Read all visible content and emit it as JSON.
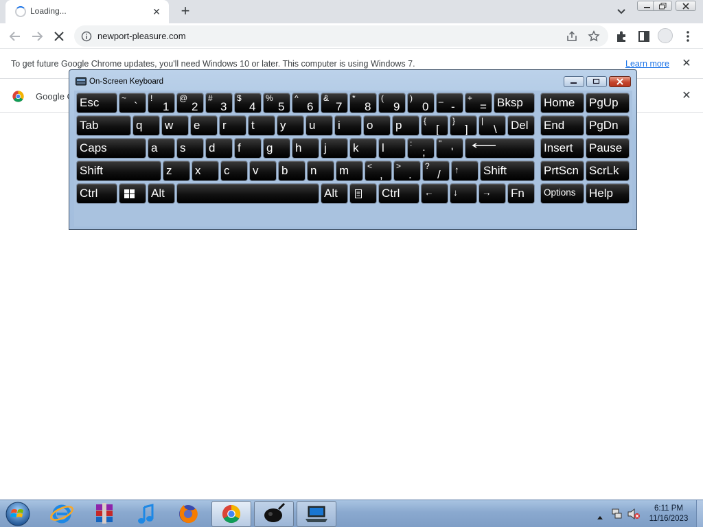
{
  "browser": {
    "tab": {
      "title": "Loading...",
      "close": "✕"
    },
    "new_tab": "+",
    "address": "newport-pleasure.com",
    "infobar_update": {
      "message": "To get future Google Chrome updates, you'll need Windows 10 or later. This computer is using Windows 7.",
      "link": "Learn more",
      "close": "✕"
    },
    "infobar_google": {
      "text": "Google C",
      "close": "✕"
    }
  },
  "osk": {
    "title": "On-Screen Keyboard",
    "rows": [
      [
        {
          "id": "esc",
          "label": "Esc",
          "w": 60
        },
        {
          "id": "tilde",
          "shift": "~",
          "low": "`",
          "w": 40
        },
        {
          "id": "1",
          "shift": "!",
          "low": "1",
          "w": 40
        },
        {
          "id": "2",
          "shift": "@",
          "low": "2",
          "w": 40
        },
        {
          "id": "3",
          "shift": "#",
          "low": "3",
          "w": 40
        },
        {
          "id": "4",
          "shift": "$",
          "low": "4",
          "w": 40
        },
        {
          "id": "5",
          "shift": "%",
          "low": "5",
          "w": 40
        },
        {
          "id": "6",
          "shift": "^",
          "low": "6",
          "w": 40
        },
        {
          "id": "7",
          "shift": "&",
          "low": "7",
          "w": 40
        },
        {
          "id": "8",
          "shift": "*",
          "low": "8",
          "w": 40
        },
        {
          "id": "9",
          "shift": "(",
          "low": "9",
          "w": 40
        },
        {
          "id": "0",
          "shift": ")",
          "low": "0",
          "w": 40
        },
        {
          "id": "minus",
          "shift": "_",
          "low": "-",
          "w": 40
        },
        {
          "id": "equals",
          "shift": "+",
          "low": "=",
          "w": 40
        },
        {
          "id": "bksp",
          "label": "Bksp",
          "w": 60
        },
        {
          "id": "home",
          "label": "Home",
          "gap": 6,
          "w": 64
        },
        {
          "id": "pgup",
          "label": "PgUp",
          "w": 64
        }
      ],
      [
        {
          "id": "tab",
          "label": "Tab",
          "w": 80
        },
        {
          "id": "q",
          "label": "q",
          "w": 40
        },
        {
          "id": "w",
          "label": "w",
          "w": 40
        },
        {
          "id": "e",
          "label": "e",
          "w": 40
        },
        {
          "id": "r",
          "label": "r",
          "w": 40
        },
        {
          "id": "t",
          "label": "t",
          "w": 40
        },
        {
          "id": "y",
          "label": "y",
          "w": 40
        },
        {
          "id": "u",
          "label": "u",
          "w": 40
        },
        {
          "id": "i",
          "label": "i",
          "w": 40
        },
        {
          "id": "o",
          "label": "o",
          "w": 40
        },
        {
          "id": "p",
          "label": "p",
          "w": 40
        },
        {
          "id": "lbracket",
          "shift": "{",
          "low": "[",
          "w": 40
        },
        {
          "id": "rbracket",
          "shift": "}",
          "low": "]",
          "w": 40
        },
        {
          "id": "backslash",
          "shift": "|",
          "low": "\\",
          "w": 40
        },
        {
          "id": "del",
          "label": "Del",
          "w": 40
        },
        {
          "id": "end",
          "label": "End",
          "gap": 6,
          "w": 64
        },
        {
          "id": "pgdn",
          "label": "PgDn",
          "w": 64
        }
      ],
      [
        {
          "id": "caps",
          "label": "Caps",
          "w": 102
        },
        {
          "id": "a",
          "label": "a",
          "w": 40
        },
        {
          "id": "s",
          "label": "s",
          "w": 40
        },
        {
          "id": "d",
          "label": "d",
          "w": 40
        },
        {
          "id": "f",
          "label": "f",
          "w": 40
        },
        {
          "id": "g",
          "label": "g",
          "w": 40
        },
        {
          "id": "h",
          "label": "h",
          "w": 40
        },
        {
          "id": "j",
          "label": "j",
          "w": 40
        },
        {
          "id": "k",
          "label": "k",
          "w": 40
        },
        {
          "id": "l",
          "label": "l",
          "w": 40
        },
        {
          "id": "semicolon",
          "shift": ":",
          "low": ";",
          "w": 40
        },
        {
          "id": "quote",
          "shift": "\"",
          "low": "'",
          "w": 40
        },
        {
          "id": "enter",
          "label": "",
          "icon": "enter-arrow-icon",
          "w": 102
        },
        {
          "id": "insert",
          "label": "Insert",
          "gap": 6,
          "w": 64
        },
        {
          "id": "pause",
          "label": "Pause",
          "w": 64
        }
      ],
      [
        {
          "id": "lshift",
          "label": "Shift",
          "w": 124
        },
        {
          "id": "z",
          "label": "z",
          "w": 40
        },
        {
          "id": "x",
          "label": "x",
          "w": 40
        },
        {
          "id": "c",
          "label": "c",
          "w": 40
        },
        {
          "id": "v",
          "label": "v",
          "w": 40
        },
        {
          "id": "b",
          "label": "b",
          "w": 40
        },
        {
          "id": "n",
          "label": "n",
          "w": 40
        },
        {
          "id": "m",
          "label": "m",
          "w": 40
        },
        {
          "id": "comma",
          "shift": "<",
          "low": ",",
          "w": 40
        },
        {
          "id": "period",
          "shift": ">",
          "low": ".",
          "w": 40
        },
        {
          "id": "slash",
          "shift": "?",
          "low": "/",
          "w": 40
        },
        {
          "id": "up",
          "label": "↑",
          "small": true,
          "w": 40
        },
        {
          "id": "rshift",
          "label": "Shift",
          "w": 80
        },
        {
          "id": "prtscn",
          "label": "PrtScn",
          "gap": 6,
          "w": 64
        },
        {
          "id": "scrlk",
          "label": "ScrLk",
          "w": 64
        }
      ],
      [
        {
          "id": "lctrl",
          "label": "Ctrl",
          "w": 60
        },
        {
          "id": "win",
          "label": "",
          "icon": "windows-logo-icon",
          "w": 40
        },
        {
          "id": "lalt",
          "label": "Alt",
          "w": 40
        },
        {
          "id": "space",
          "label": "",
          "w": 208
        },
        {
          "id": "ralt",
          "label": "Alt",
          "w": 40
        },
        {
          "id": "menu",
          "label": "",
          "icon": "context-menu-icon",
          "w": 40
        },
        {
          "id": "rctrl",
          "label": "Ctrl",
          "w": 60
        },
        {
          "id": "left",
          "label": "←",
          "small": true,
          "w": 40
        },
        {
          "id": "down",
          "label": "↓",
          "small": true,
          "w": 40
        },
        {
          "id": "right",
          "label": "→",
          "small": true,
          "w": 40
        },
        {
          "id": "fn",
          "label": "Fn",
          "w": 40
        },
        {
          "id": "options",
          "label": "Options",
          "small": true,
          "gap": 6,
          "w": 64
        },
        {
          "id": "help",
          "label": "Help",
          "w": 64
        }
      ]
    ]
  },
  "taskbar": {
    "time": "6:11 PM",
    "date": "11/16/2023",
    "items": [
      "internet-explorer",
      "winrar",
      "itunes",
      "firefox",
      "chrome",
      "app-black",
      "app-laptop"
    ]
  }
}
